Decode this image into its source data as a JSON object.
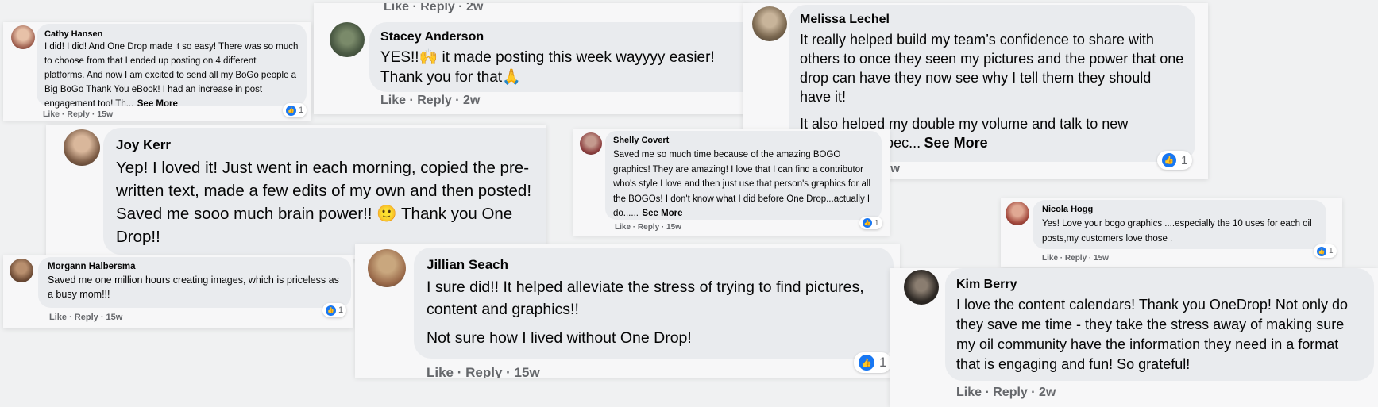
{
  "meta_words": {
    "like": "Like",
    "reply": "Reply",
    "sep": " · "
  },
  "comments": {
    "cathy": {
      "name": "Cathy Hansen",
      "text": "I did! I did! And One Drop made it so easy! There was so much to choose from that I ended up posting on 4 different platforms. And now I am excited to send all my BoGo people a Big BoGo Thank You eBook! I had an increase in post engagement too! Th...",
      "see_more": "See More",
      "time": "15w",
      "reactions": "1"
    },
    "stacey": {
      "name": "Stacey Anderson",
      "text": "YES!!🙌 it made posting this week wayyyy easier! Thank you for that🙏",
      "time": "2w",
      "top_time": "2w"
    },
    "melissa": {
      "name": "Melissa Lechel",
      "text": "It really helped build my team’s confidence to share with others to once they seen my pictures and the power that one drop can have they now see why I tell them they should have it!",
      "text2": "It also helped my double my volume and talk to new potentials! Espec...",
      "see_more": "See More",
      "time": "15w",
      "reactions": "1"
    },
    "joy": {
      "name": "Joy Kerr",
      "text": "Yep! I loved it! Just went in each morning, copied the pre-written text, made a few edits of my own and then posted! Saved me sooo much brain power!! 🙂 Thank you One Drop!!"
    },
    "shelly": {
      "name": "Shelly Covert",
      "text": "Saved me so much time because of the amazing BOGO graphics! They are amazing! I love that I can find a contributor who's style I love and then just use that person's graphics for all the BOGOs! I don't know what I did before One Drop...actually I do......",
      "see_more": "See More",
      "time": "15w",
      "reactions": "1"
    },
    "nicola": {
      "name": "Nicola Hogg",
      "text": "Yes! Love your bogo graphics ....especially the 10 uses for each oil posts,my customers love those .",
      "time": "15w",
      "reactions": "1"
    },
    "morgann": {
      "name": "Morgann Halbersma",
      "text": "Saved me one million hours creating images, which is priceless as a busy mom!!!",
      "time": "15w",
      "reactions": "1"
    },
    "jillian": {
      "name": "Jillian Seach",
      "text": "I sure did!! It helped alleviate the stress of trying to find pictures, content and graphics!!",
      "text2": "Not sure how I lived without One Drop!",
      "time": "15w",
      "reactions": "1"
    },
    "kim": {
      "name": "Kim Berry",
      "text": "I love the content calendars! Thank you OneDrop! Not only do they save me time - they take the stress away of making sure my oil community have the information they need in a format that is engaging and fun! So grateful!",
      "time": "2w"
    }
  },
  "colors": {
    "bubble": "#e9ebee",
    "meta": "#65676b",
    "like_blue": "#1877f2"
  }
}
